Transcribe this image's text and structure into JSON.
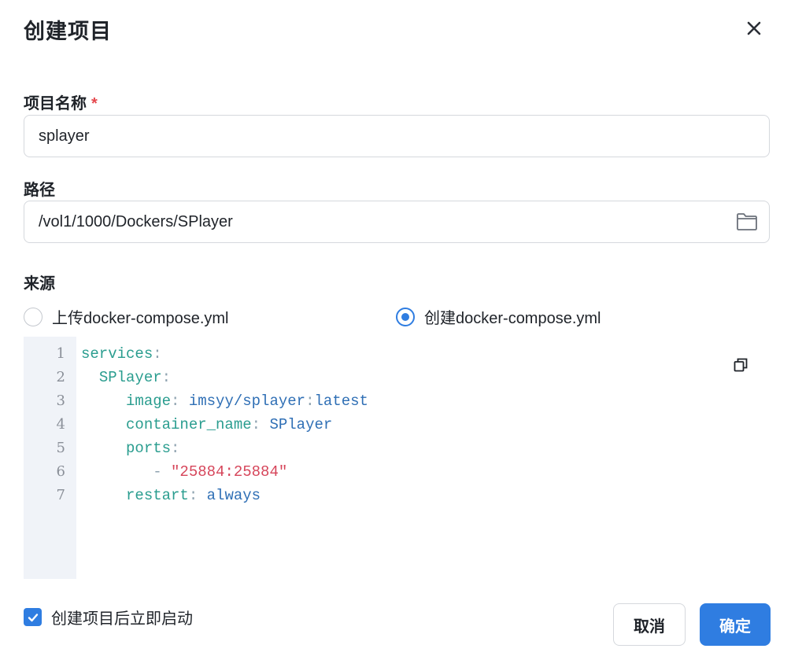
{
  "dialog": {
    "title": "创建项目"
  },
  "form": {
    "name_label": "项目名称",
    "required_mark": "*",
    "name_value": "splayer",
    "path_label": "路径",
    "path_value": "/vol1/1000/Dockers/SPlayer",
    "source_label": "来源",
    "source_options": [
      {
        "label": "上传docker-compose.yml",
        "selected": false
      },
      {
        "label": "创建docker-compose.yml",
        "selected": true
      }
    ]
  },
  "editor": {
    "lines": [
      {
        "no": "1",
        "key": "services",
        "sep": ":",
        "val": "",
        "str": ""
      },
      {
        "no": "2",
        "key": "SPlayer",
        "sep": ":",
        "val": "",
        "str": ""
      },
      {
        "no": "3",
        "key": "image",
        "sep": ": ",
        "val": "imsyy/splayer",
        "sep2": ":",
        "val2": "latest",
        "str": ""
      },
      {
        "no": "4",
        "key": "container_name",
        "sep": ": ",
        "val": "SPlayer",
        "str": ""
      },
      {
        "no": "5",
        "key": "ports",
        "sep": ":",
        "val": "",
        "str": ""
      },
      {
        "no": "6",
        "key": "",
        "sep": "- ",
        "val": "",
        "str": "\"25884:25884\""
      },
      {
        "no": "7",
        "key": "restart",
        "sep": ": ",
        "val": "always",
        "str": ""
      }
    ]
  },
  "footer": {
    "autostart_label": "创建项目后立即启动",
    "autostart_checked": true,
    "cancel_label": "取消",
    "ok_label": "确定"
  },
  "colors": {
    "primary": "#2f7de1",
    "required": "#e5484d",
    "yaml_key": "#2a9d8f",
    "yaml_value": "#2f6fb5",
    "yaml_string": "#d6455a"
  },
  "icons": {
    "close": "close-icon",
    "folder": "folder-icon",
    "copy": "copy-icon",
    "check": "check-icon"
  }
}
